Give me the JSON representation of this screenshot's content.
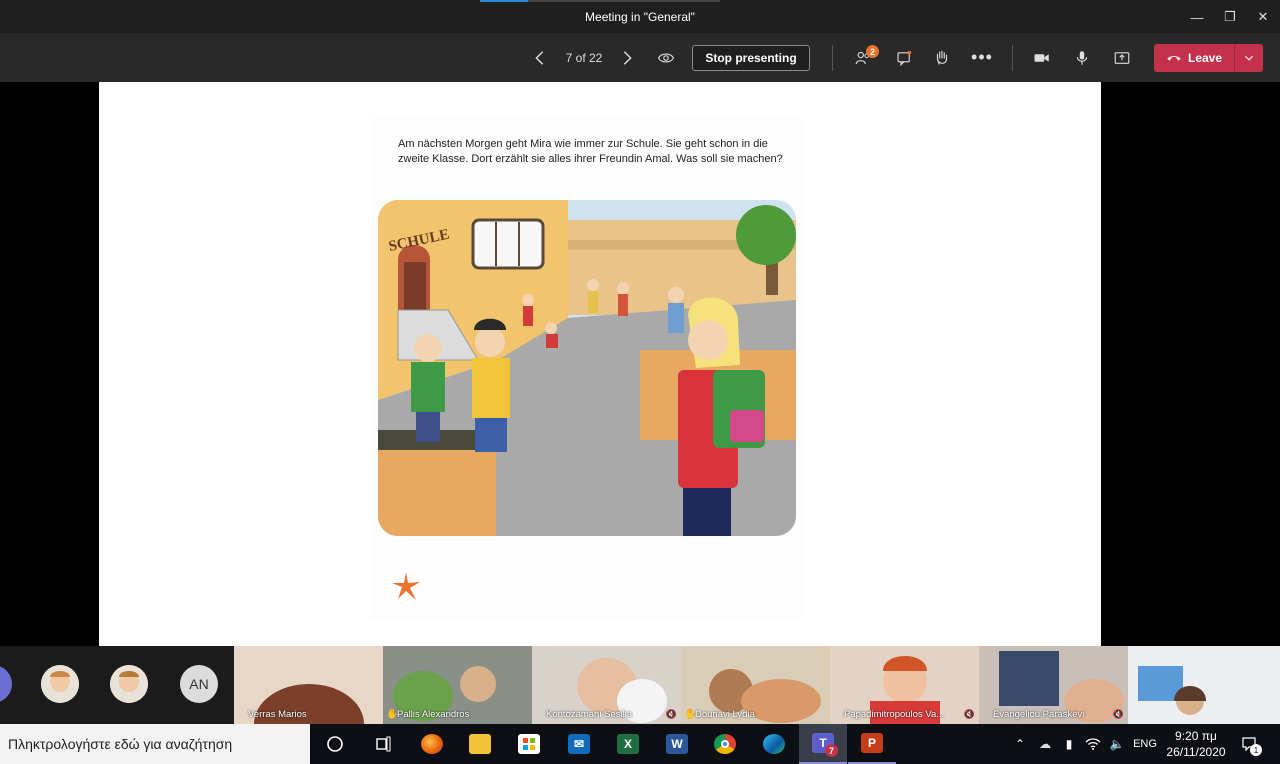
{
  "window": {
    "title": "Meeting in \"General\""
  },
  "toolbar": {
    "page_indicator": "7 of 22",
    "stop_presenting_label": "Stop presenting",
    "participants_badge": "2",
    "leave_label": "Leave"
  },
  "slide": {
    "story_text": "Am nächsten Morgen geht Mira wie immer zur Schule. Sie geht schon in die zweite Klasse. Dort erzählt sie alles ihrer Freundin Amal. Was soll sie machen?",
    "sign_text": "SCHULE"
  },
  "participants": {
    "avatar_initials": "AN",
    "tiles": [
      {
        "name": "Verras Marios",
        "hand": false,
        "muted": false
      },
      {
        "name": "Pallis Alexandros",
        "hand": true,
        "muted": false
      },
      {
        "name": "Kontozamani Sesilia",
        "hand": false,
        "muted": true
      },
      {
        "name": "Dounavi Lydia",
        "hand": true,
        "muted": false
      },
      {
        "name": "Papadimitropoulos Va...",
        "hand": false,
        "muted": true
      },
      {
        "name": "Evangeliou Paraskevi",
        "hand": false,
        "muted": true
      }
    ]
  },
  "taskbar": {
    "search_placeholder": "Πληκτρολογήστε εδώ για αναζήτηση",
    "teams_badge": "7",
    "language": "ENG",
    "time": "9:20 πμ",
    "date": "26/11/2020",
    "notifications_count": "1"
  },
  "colors": {
    "leave_red": "#c4314b",
    "toolbar_bg": "#292929",
    "badge_orange": "#e8732c"
  }
}
